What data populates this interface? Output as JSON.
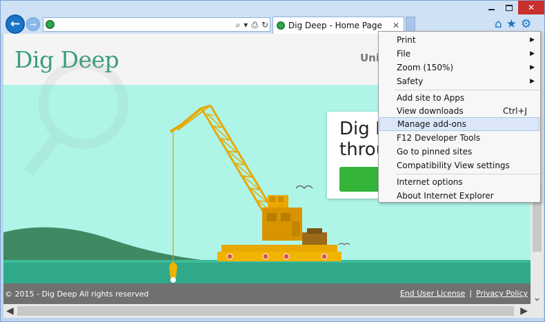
{
  "colors": {
    "accent": "#1b75c9",
    "logo": "#3a9e7c",
    "hero_bg": "#aef5e8",
    "crane": "#f0b400",
    "cta": "#34b53a",
    "footer_bg": "#707070",
    "menu_highlight": "#dbe7f8"
  },
  "window": {
    "min_icon": "minimize-icon",
    "max_icon": "maximize-icon",
    "close_label": "✕"
  },
  "toolbar": {
    "back_icon": "back-arrow-icon",
    "forward_icon": "forward-arrow-icon",
    "search_glyph": "⌕",
    "dropdown_glyph": "▾",
    "compat_glyph": "⎙",
    "refresh_glyph": "↻",
    "home_glyph": "⌂",
    "favorites_glyph": "★",
    "tools_glyph": "⚙"
  },
  "tab": {
    "title": "Dig Deep - Home Page",
    "close_glyph": "✕"
  },
  "page": {
    "logo": "Dig Deep",
    "nav_partial": "Uni",
    "promo_headline": "Dig D\nthrou",
    "footer_copyright": "© 2015 - Dig Deep All rights reserved",
    "footer_links": [
      "End User License",
      "Privacy Policy"
    ],
    "footer_separator": "|"
  },
  "menu": {
    "items": [
      {
        "label": "Print",
        "submenu": true
      },
      {
        "label": "File",
        "submenu": true
      },
      {
        "label": "Zoom (150%)",
        "submenu": true
      },
      {
        "label": "Safety",
        "submenu": true
      },
      {
        "label": "Add site to Apps"
      },
      {
        "label": "View downloads",
        "shortcut": "Ctrl+J"
      },
      {
        "label": "Manage add-ons",
        "highlighted": true
      },
      {
        "label": "F12 Developer Tools"
      },
      {
        "label": "Go to pinned sites"
      },
      {
        "label": "Compatibility View settings"
      },
      {
        "label": "Internet options"
      },
      {
        "label": "About Internet Explorer"
      }
    ],
    "submenu_glyph": "▶"
  },
  "scroll": {
    "down_glyph": "⌄",
    "left_glyph": "◀",
    "right_glyph": "▶"
  }
}
